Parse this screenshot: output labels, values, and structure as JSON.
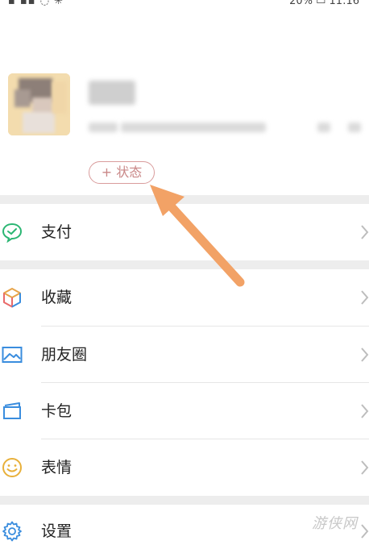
{
  "status_bar": {
    "left": "▪ ▪▪ ◌ ✳",
    "right": "20% ▭ 11:16"
  },
  "profile": {
    "status_button_label": "+ 状态"
  },
  "menu": {
    "pay": {
      "label": "支付",
      "icon": "wechat-pay-icon",
      "color": "#2bb673"
    },
    "favorites": {
      "label": "收藏",
      "icon": "cube-icon",
      "color": "#e7a44a"
    },
    "moments": {
      "label": "朋友圈",
      "icon": "photo-icon",
      "color": "#3a8dde"
    },
    "cards": {
      "label": "卡包",
      "icon": "wallet-icon",
      "color": "#3a8dde"
    },
    "stickers": {
      "label": "表情",
      "icon": "smile-icon",
      "color": "#e8b03a"
    },
    "settings": {
      "label": "设置",
      "icon": "gear-icon",
      "color": "#3a8dde"
    }
  },
  "annotation": {
    "arrow_color": "#f2a266"
  },
  "watermark": "游侠网"
}
